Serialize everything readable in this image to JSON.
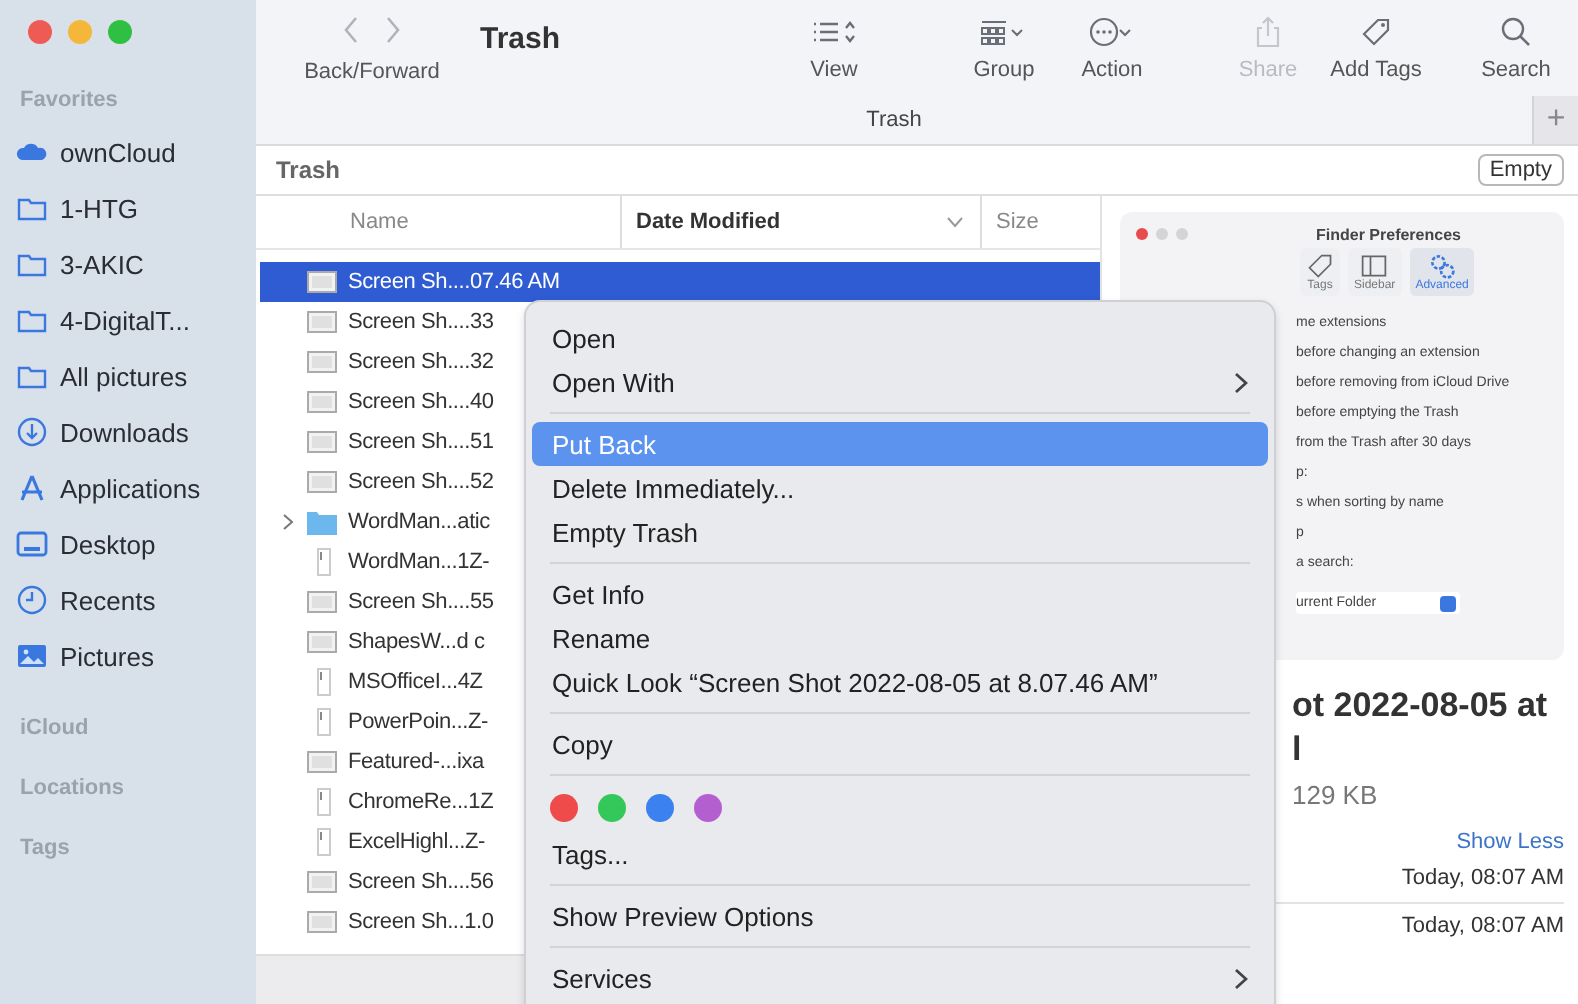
{
  "toolbar": {
    "nav_label": "Back/Forward",
    "title": "Trash",
    "items": [
      {
        "kind": "view",
        "label": "View",
        "disabled": false
      },
      {
        "kind": "group",
        "label": "Group",
        "disabled": false
      },
      {
        "kind": "action",
        "label": "Action",
        "disabled": false
      },
      {
        "kind": "share",
        "label": "Share",
        "disabled": true
      },
      {
        "kind": "tag",
        "label": "Add Tags",
        "disabled": false
      },
      {
        "kind": "search",
        "label": "Search",
        "disabled": false
      }
    ]
  },
  "tabs": [
    {
      "label": "Trash",
      "selected": true
    }
  ],
  "new_tab": "+",
  "path_bar": {
    "title": "Trash",
    "button": "Empty"
  },
  "sidebar": {
    "sections": [
      {
        "title": "Favorites",
        "items": [
          {
            "label": "ownCloud",
            "kind": "cloud"
          },
          {
            "label": "1-HTG",
            "kind": "folder"
          },
          {
            "label": "3-AKIC",
            "kind": "folder"
          },
          {
            "label": "4-DigitalT...",
            "kind": "folder"
          },
          {
            "label": "All pictures",
            "kind": "folder"
          },
          {
            "label": "Downloads",
            "kind": "download"
          },
          {
            "label": "Applications",
            "kind": "apps"
          },
          {
            "label": "Desktop",
            "kind": "desktop"
          },
          {
            "label": "Recents",
            "kind": "clock"
          },
          {
            "label": "Pictures",
            "kind": "pictures"
          }
        ]
      },
      {
        "title": "iCloud"
      },
      {
        "title": "Locations"
      },
      {
        "title": "Tags"
      }
    ]
  },
  "file_list": {
    "columns": [
      {
        "label": "Name",
        "sorted": false
      },
      {
        "label": "Date Modified",
        "sorted": true
      },
      {
        "label": "Size",
        "sorted": false
      }
    ],
    "rows": [
      {
        "name": "Screen Sh....07.46 AM",
        "kind": "file",
        "selected": true
      },
      {
        "name": "Screen Sh....33",
        "kind": "file",
        "selected": false
      },
      {
        "name": "Screen Sh....32",
        "kind": "file",
        "selected": false
      },
      {
        "name": "Screen Sh....40",
        "kind": "file",
        "selected": false
      },
      {
        "name": "Screen Sh....51",
        "kind": "file",
        "selected": false
      },
      {
        "name": "Screen Sh....52",
        "kind": "file",
        "selected": false
      },
      {
        "name": "WordMan...atic",
        "kind": "folder",
        "selected": false
      },
      {
        "name": "WordMan...1Z-",
        "kind": "doc",
        "selected": false
      },
      {
        "name": "Screen Sh....55",
        "kind": "file",
        "selected": false
      },
      {
        "name": "ShapesW...d c",
        "kind": "file",
        "selected": false
      },
      {
        "name": "MSOfficeI...4Z",
        "kind": "doc",
        "selected": false
      },
      {
        "name": "PowerPoin...Z-",
        "kind": "doc",
        "selected": false
      },
      {
        "name": "Featured-...ixa",
        "kind": "file",
        "selected": false
      },
      {
        "name": "ChromeRe...1Z",
        "kind": "doc",
        "selected": false
      },
      {
        "name": "ExcelHighl...Z-",
        "kind": "doc",
        "selected": false
      },
      {
        "name": "Screen Sh....56",
        "kind": "file",
        "selected": false
      },
      {
        "name": "Screen Sh...1.0",
        "kind": "file",
        "selected": false
      }
    ]
  },
  "preview": {
    "thumbnail": {
      "title": "Finder Preferences",
      "tabs": [
        {
          "label": "Tags",
          "kind": "tag",
          "selected": false
        },
        {
          "label": "Sidebar",
          "kind": "sidebar",
          "selected": false
        },
        {
          "label": "Advanced",
          "kind": "gears",
          "selected": true
        }
      ],
      "lines": [
        "me extensions",
        "before changing an extension",
        "before removing from iCloud Drive",
        "before emptying the Trash",
        "from the Trash after 30 days",
        "p:",
        "s when sorting by name",
        "p",
        "a search:"
      ],
      "popup": "urrent Folder"
    },
    "title_lines": [
      "ot 2022-08-05 at",
      "l"
    ],
    "size": "129 KB",
    "link": "Show Less",
    "dates": [
      "Today, 08:07 AM",
      "Today, 08:07 AM"
    ]
  },
  "context_menu": {
    "groups": [
      [
        {
          "kind": "item",
          "label": "Open",
          "submenu": false,
          "selected": false
        },
        {
          "kind": "item",
          "label": "Open With",
          "submenu": true,
          "selected": false
        }
      ],
      [
        {
          "kind": "item",
          "label": "Put Back",
          "submenu": false,
          "selected": true
        },
        {
          "kind": "item",
          "label": "Delete Immediately...",
          "submenu": false,
          "selected": false
        },
        {
          "kind": "item",
          "label": "Empty Trash",
          "submenu": false,
          "selected": false
        }
      ],
      [
        {
          "kind": "item",
          "label": "Get Info",
          "submenu": false,
          "selected": false
        },
        {
          "kind": "item",
          "label": "Rename",
          "submenu": false,
          "selected": false
        },
        {
          "kind": "item",
          "label": "Quick Look “Screen Shot 2022-08-05 at 8.07.46 AM”",
          "submenu": false,
          "selected": false
        }
      ],
      [
        {
          "kind": "item",
          "label": "Copy",
          "submenu": false,
          "selected": false
        }
      ],
      [
        {
          "kind": "colors",
          "colors": [
            {
              "color": "#ef4b4b"
            },
            {
              "color": "#34c759"
            },
            {
              "color": "#3b82f0"
            },
            {
              "color": "#b35fd0"
            }
          ]
        },
        {
          "kind": "item",
          "label": "Tags...",
          "submenu": false,
          "selected": false
        }
      ],
      [
        {
          "kind": "item",
          "label": "Show Preview Options",
          "submenu": false,
          "selected": false
        }
      ],
      [
        {
          "kind": "item",
          "label": "Services",
          "submenu": true,
          "selected": false
        }
      ]
    ]
  }
}
